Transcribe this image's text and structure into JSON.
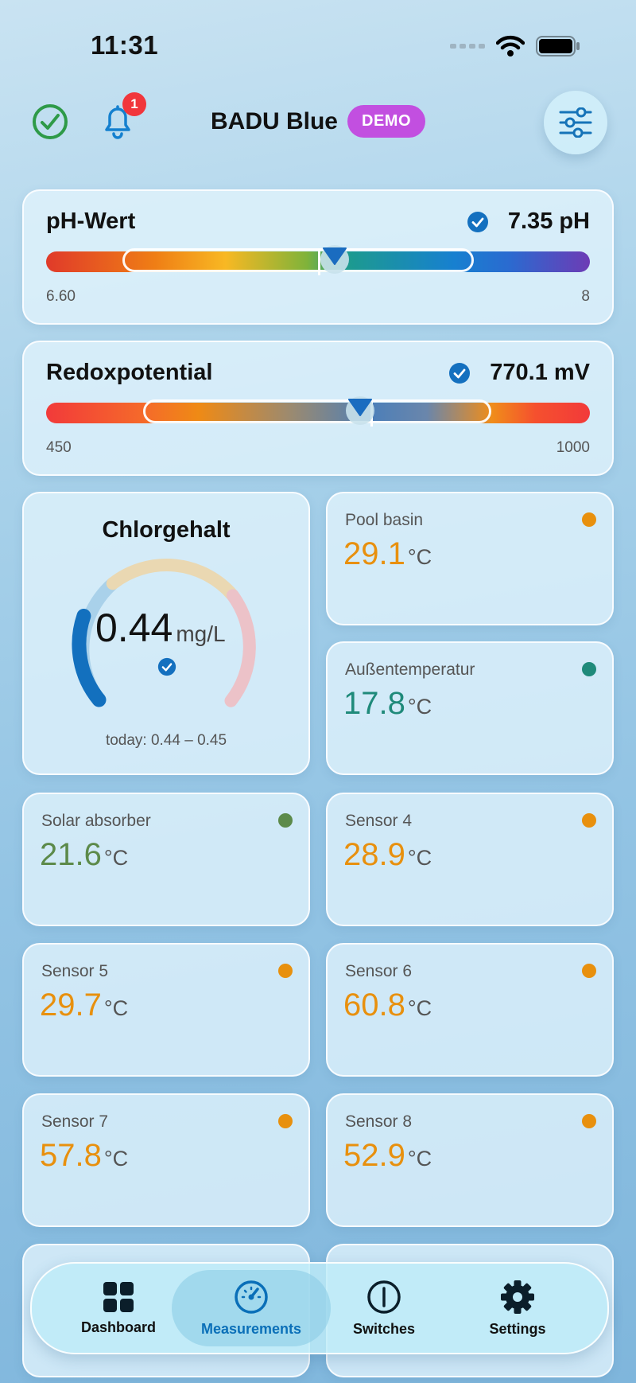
{
  "status_bar": {
    "time": "11:31"
  },
  "header": {
    "title": "BADU Blue",
    "demo_label": "DEMO",
    "notification_count": "1"
  },
  "ph": {
    "title": "pH-Wert",
    "value": "7.35",
    "unit": "pH",
    "min": "6.60",
    "max": "8"
  },
  "redox": {
    "title": "Redoxpotential",
    "value": "770.1",
    "unit": "mV",
    "min": "450",
    "max": "1000"
  },
  "chlor": {
    "title": "Chlorgehalt",
    "value": "0.44",
    "unit": "mg/L",
    "range": "today: 0.44 – 0.45"
  },
  "sensors": [
    {
      "label": "Pool basin",
      "value": "29.1",
      "unit": "°C",
      "color": "#e8900e"
    },
    {
      "label": "Außentemperatur",
      "value": "17.8",
      "unit": "°C",
      "color": "#1f8a7a"
    },
    {
      "label": "Solar absorber",
      "value": "21.6",
      "unit": "°C",
      "color": "#5c8a4a"
    },
    {
      "label": "Sensor 4",
      "value": "28.9",
      "unit": "°C",
      "color": "#e8900e"
    },
    {
      "label": "Sensor 5",
      "value": "29.7",
      "unit": "°C",
      "color": "#e8900e"
    },
    {
      "label": "Sensor 6",
      "value": "60.8",
      "unit": "°C",
      "color": "#e8900e"
    },
    {
      "label": "Sensor 7",
      "value": "57.8",
      "unit": "°C",
      "color": "#e8900e"
    },
    {
      "label": "Sensor 8",
      "value": "52.9",
      "unit": "°C",
      "color": "#e8900e"
    }
  ],
  "tabs": [
    {
      "label": "Dashboard",
      "icon": "grid-icon"
    },
    {
      "label": "Measurements",
      "icon": "gauge-icon"
    },
    {
      "label": "Switches",
      "icon": "power-icon"
    },
    {
      "label": "Settings",
      "icon": "gear-icon"
    }
  ],
  "colors": {
    "accent": "#0a6fb8",
    "demo": "#c24fe0",
    "badge": "#f1363c",
    "status_ok": "#2e9a48"
  }
}
